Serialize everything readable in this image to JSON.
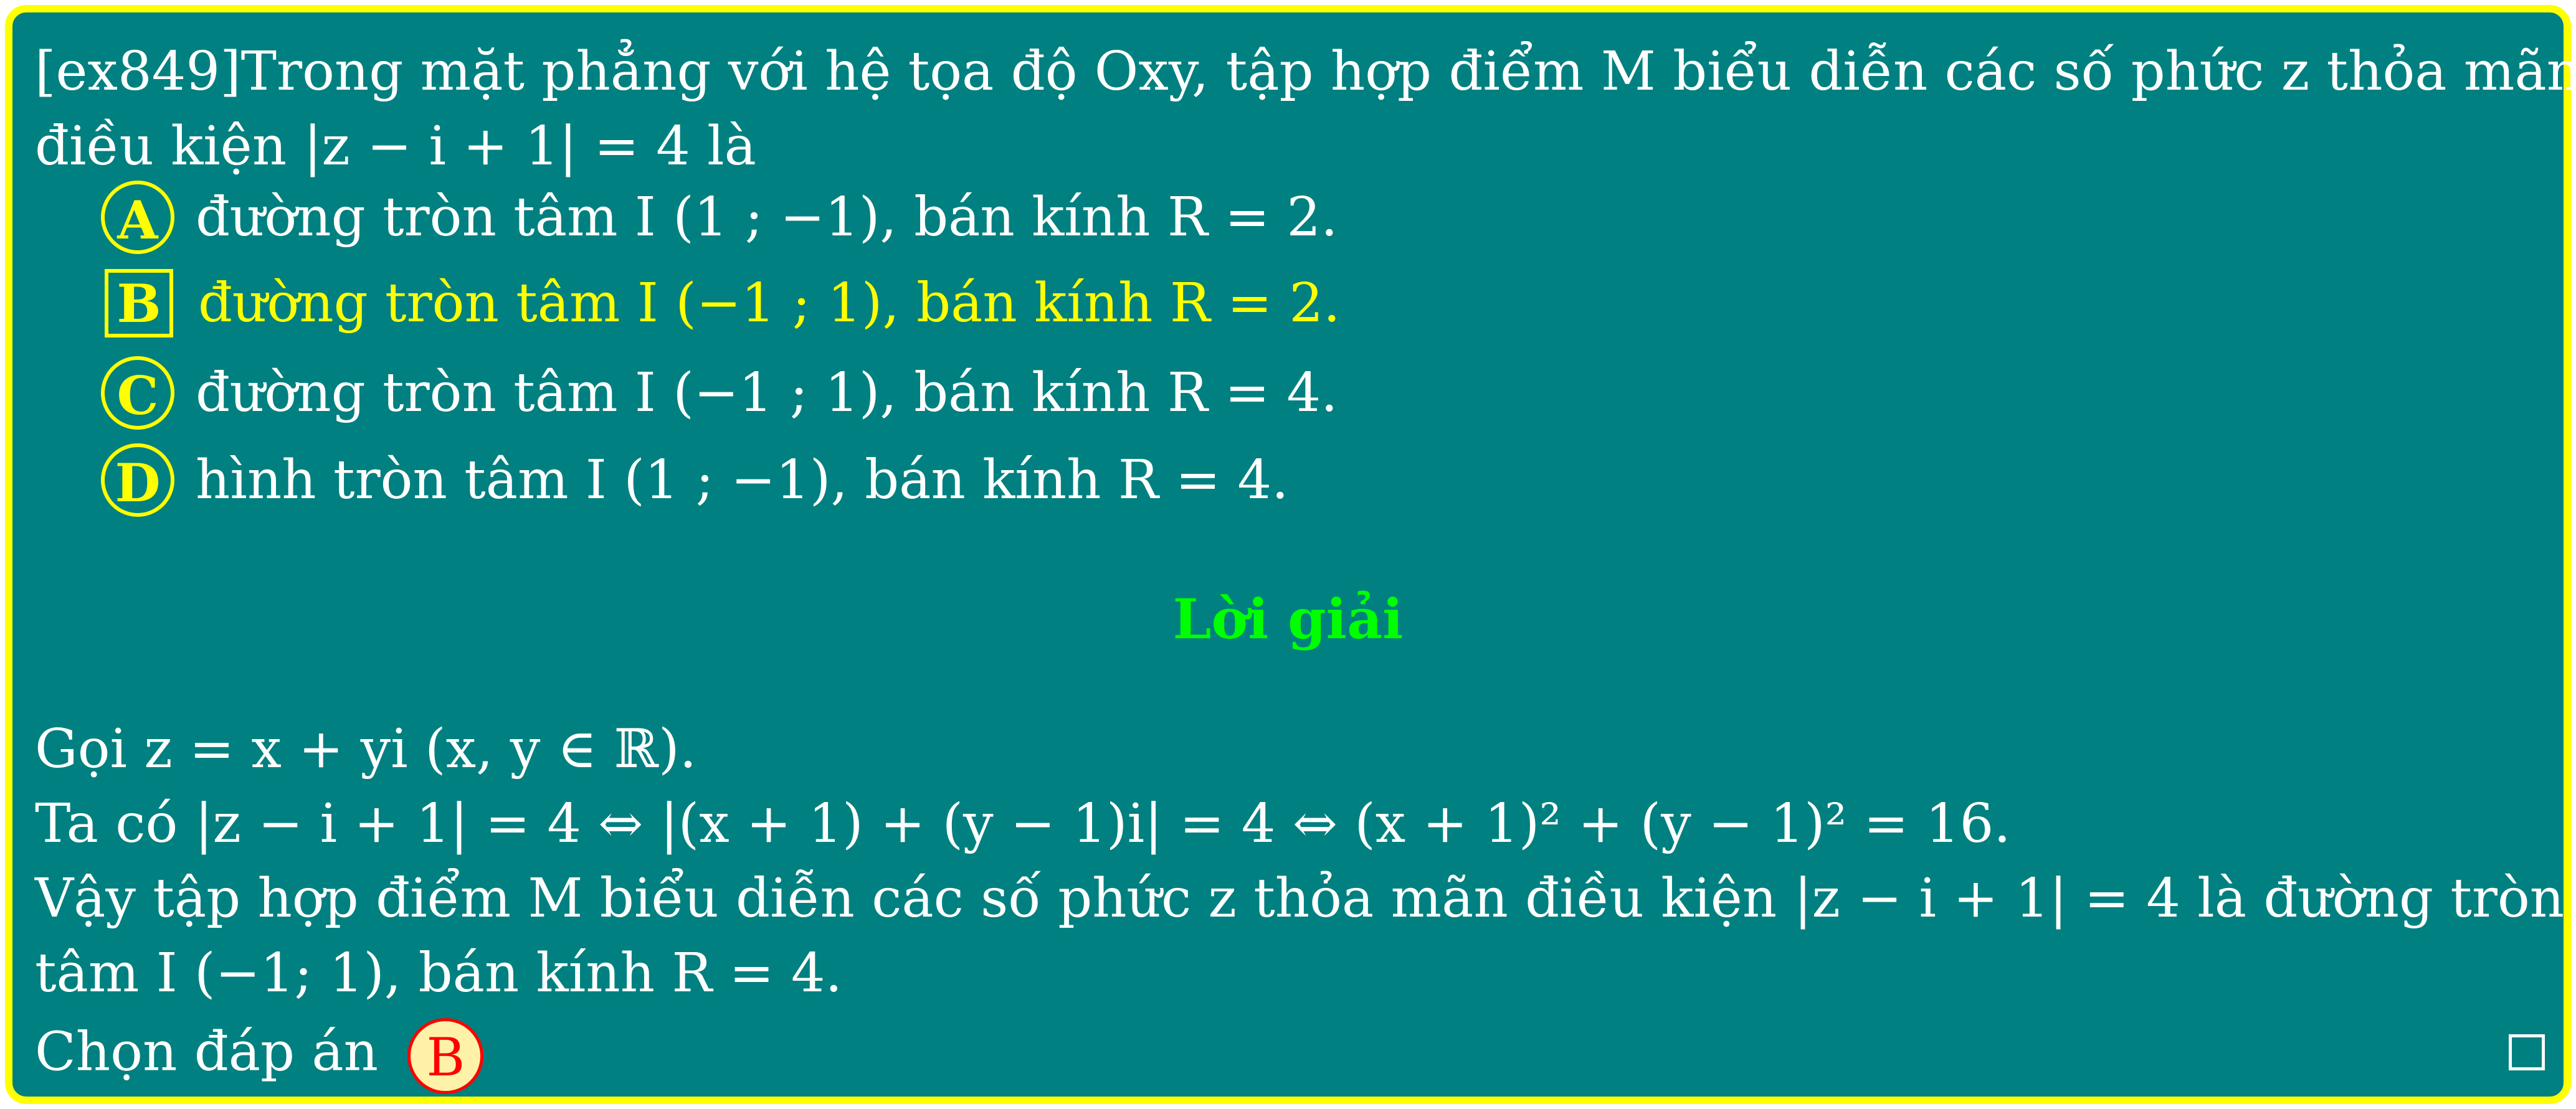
{
  "question": {
    "line1": "[ex849]Trong mặt phẳng với hệ tọa độ Oxy, tập hợp điểm M biểu diễn các số phức z thỏa mãn",
    "line2": "điều kiện |z − i + 1| = 4 là"
  },
  "choices": [
    {
      "label": "A",
      "text": "đường tròn tâm I (1 ; −1), bán kính R = 2.",
      "style": "circle"
    },
    {
      "label": "B",
      "text": "đường tròn tâm I (−1 ; 1), bán kính R = 2.",
      "style": "square-highlighted"
    },
    {
      "label": "C",
      "text": "đường tròn tâm I (−1 ; 1), bán kính R = 4.",
      "style": "circle"
    },
    {
      "label": "D",
      "text": "hình tròn tâm I (1 ; −1), bán kính R = 4.",
      "style": "circle"
    }
  ],
  "solution": {
    "title": "Lời giải",
    "line1": "Gọi z = x + yi (x, y ∈ ℝ).",
    "line2": "Ta có |z − i + 1| = 4 ⇔ |(x + 1) + (y − 1)i| = 4 ⇔ (x + 1)² + (y − 1)² = 16.",
    "line3": "Vậy tập hợp điểm M biểu diễn các số phức z thỏa mãn điều kiện |z − i + 1| = 4 là đường tròn",
    "line4": "tâm I (−1; 1), bán kính R = 4.",
    "answer_prefix": "Chọn đáp án",
    "answer_label": "B"
  },
  "colors": {
    "background": "#008080",
    "border": "#ffff00",
    "text": "#ffffff",
    "highlight": "#ffff00",
    "solution_title": "#00ff00",
    "answer_badge_fill": "#fff2a8",
    "answer_badge_text": "#ff0000"
  },
  "icons": {
    "qed": "end-of-proof-square-icon"
  }
}
